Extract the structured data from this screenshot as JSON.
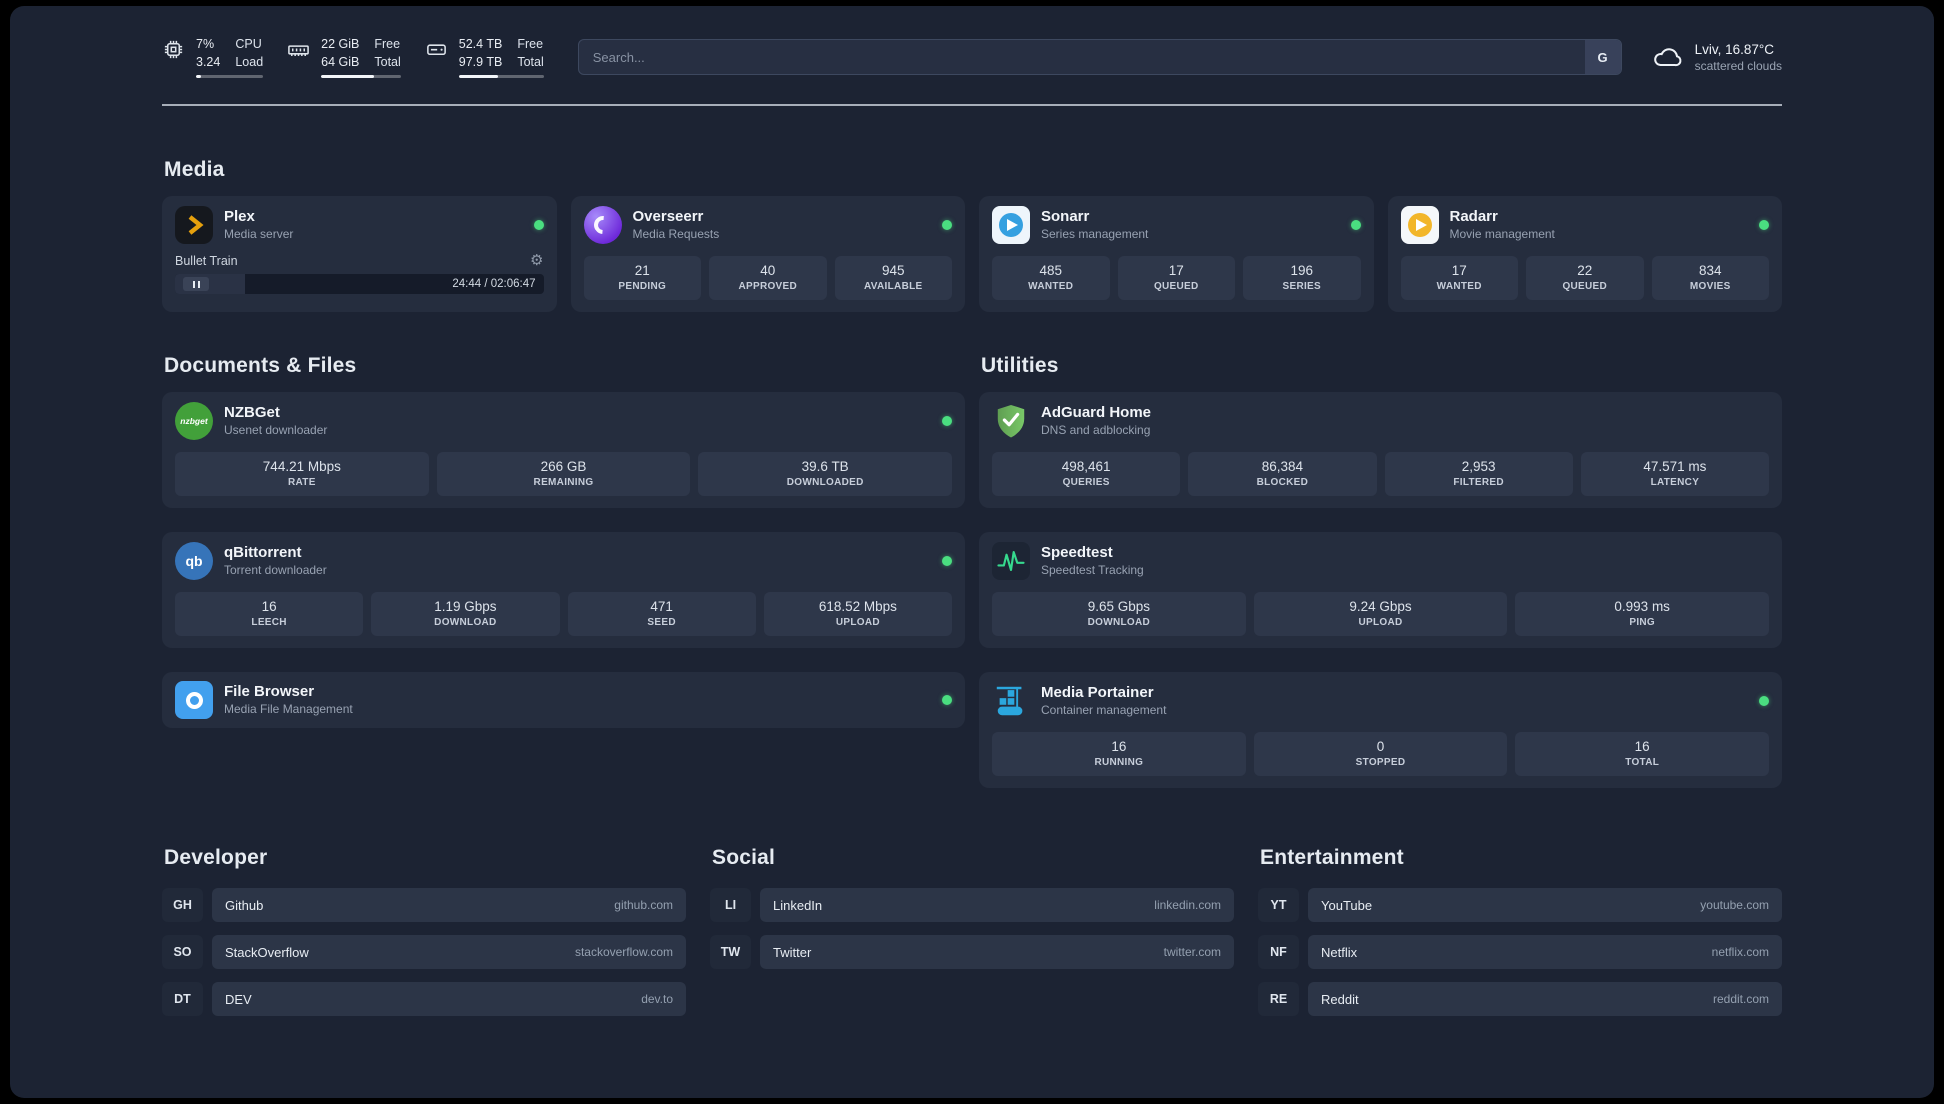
{
  "topbar": {
    "cpu": {
      "value1": "7%",
      "value2": "3.24",
      "label1": "CPU",
      "label2": "Load"
    },
    "memory": {
      "value1": "22 GiB",
      "value2": "64 GiB",
      "label1": "Free",
      "label2": "Total"
    },
    "disk": {
      "value1": "52.4 TB",
      "value2": "97.9 TB",
      "label1": "Free",
      "label2": "Total"
    },
    "search": {
      "placeholder": "Search...",
      "provider_label": "G"
    },
    "weather": {
      "location": "Lviv, 16.87°C",
      "condition": "scattered clouds"
    }
  },
  "meters": {
    "cpu": 7,
    "memory": 66,
    "disk": 46,
    "plex_progress": 19
  },
  "sections": {
    "media": "Media",
    "documents": "Documents & Files",
    "utilities": "Utilities"
  },
  "services": {
    "plex": {
      "name": "Plex",
      "subtitle": "Media server",
      "player_title": "Bullet Train",
      "player_time": "24:44 / 02:06:47"
    },
    "overseerr": {
      "name": "Overseerr",
      "subtitle": "Media Requests",
      "stats": [
        {
          "value": "21",
          "label": "PENDING"
        },
        {
          "value": "40",
          "label": "APPROVED"
        },
        {
          "value": "945",
          "label": "AVAILABLE"
        }
      ]
    },
    "sonarr": {
      "name": "Sonarr",
      "subtitle": "Series management",
      "stats": [
        {
          "value": "485",
          "label": "WANTED"
        },
        {
          "value": "17",
          "label": "QUEUED"
        },
        {
          "value": "196",
          "label": "SERIES"
        }
      ]
    },
    "radarr": {
      "name": "Radarr",
      "subtitle": "Movie management",
      "stats": [
        {
          "value": "17",
          "label": "WANTED"
        },
        {
          "value": "22",
          "label": "QUEUED"
        },
        {
          "value": "834",
          "label": "MOVIES"
        }
      ]
    },
    "nzbget": {
      "name": "NZBGet",
      "subtitle": "Usenet downloader",
      "stats": [
        {
          "value": "744.21 Mbps",
          "label": "RATE"
        },
        {
          "value": "266 GB",
          "label": "REMAINING"
        },
        {
          "value": "39.6 TB",
          "label": "DOWNLOADED"
        }
      ]
    },
    "qbittorrent": {
      "name": "qBittorrent",
      "subtitle": "Torrent downloader",
      "stats": [
        {
          "value": "16",
          "label": "LEECH"
        },
        {
          "value": "1.19 Gbps",
          "label": "DOWNLOAD"
        },
        {
          "value": "471",
          "label": "SEED"
        },
        {
          "value": "618.52 Mbps",
          "label": "UPLOAD"
        }
      ]
    },
    "filebrowser": {
      "name": "File Browser",
      "subtitle": "Media File Management"
    },
    "adguard": {
      "name": "AdGuard Home",
      "subtitle": "DNS and adblocking",
      "stats": [
        {
          "value": "498,461",
          "label": "QUERIES"
        },
        {
          "value": "86,384",
          "label": "BLOCKED"
        },
        {
          "value": "2,953",
          "label": "FILTERED"
        },
        {
          "value": "47.571 ms",
          "label": "LATENCY"
        }
      ]
    },
    "speedtest": {
      "name": "Speedtest",
      "subtitle": "Speedtest Tracking",
      "stats": [
        {
          "value": "9.65 Gbps",
          "label": "DOWNLOAD"
        },
        {
          "value": "9.24 Gbps",
          "label": "UPLOAD"
        },
        {
          "value": "0.993 ms",
          "label": "PING"
        }
      ]
    },
    "portainer": {
      "name": "Media Portainer",
      "subtitle": "Container management",
      "stats": [
        {
          "value": "16",
          "label": "RUNNING"
        },
        {
          "value": "0",
          "label": "STOPPED"
        },
        {
          "value": "16",
          "label": "TOTAL"
        }
      ]
    }
  },
  "icon_text": {
    "nzbget": "nzbget",
    "qbittorrent": "qb"
  },
  "bookmarks": {
    "developer": {
      "title": "Developer",
      "items": [
        {
          "abbr": "GH",
          "name": "Github",
          "url": "github.com"
        },
        {
          "abbr": "SO",
          "name": "StackOverflow",
          "url": "stackoverflow.com"
        },
        {
          "abbr": "DT",
          "name": "DEV",
          "url": "dev.to"
        }
      ]
    },
    "social": {
      "title": "Social",
      "items": [
        {
          "abbr": "LI",
          "name": "LinkedIn",
          "url": "linkedin.com"
        },
        {
          "abbr": "TW",
          "name": "Twitter",
          "url": "twitter.com"
        }
      ]
    },
    "entertainment": {
      "title": "Entertainment",
      "items": [
        {
          "abbr": "YT",
          "name": "YouTube",
          "url": "youtube.com"
        },
        {
          "abbr": "NF",
          "name": "Netflix",
          "url": "netflix.com"
        },
        {
          "abbr": "RE",
          "name": "Reddit",
          "url": "reddit.com"
        }
      ]
    }
  },
  "colors": {
    "status_online": "#4ade80",
    "background": "#1c2333",
    "card": "#252d3e",
    "tile": "#2e374a",
    "plex_accent": "#e5a00d"
  }
}
